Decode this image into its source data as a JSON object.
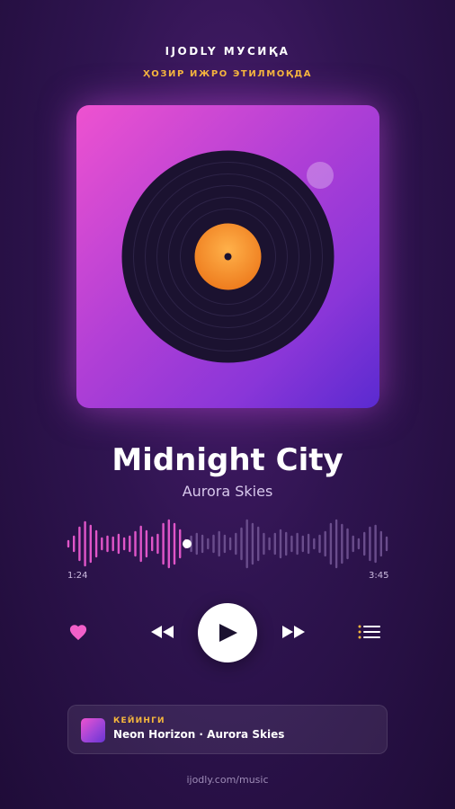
{
  "header": {
    "app_title": "IJODLY МУСИҚА",
    "now_playing": "ҲОЗИР ИЖРО ЭТИЛМОҚДА"
  },
  "track": {
    "title": "Midnight City",
    "artist": "Aurora Skies"
  },
  "progress": {
    "current_time": "1:24",
    "total_time": "3:45",
    "fraction": 0.373
  },
  "controls": {
    "like_icon": "heart-icon",
    "rewind_icon": "rewind-icon",
    "play_icon": "play-icon",
    "forward_icon": "fast-forward-icon",
    "queue_icon": "queue-icon",
    "liked": true
  },
  "up_next": {
    "label": "КЕЙИНГИ",
    "track": "Neon Horizon · Aurora Skies"
  },
  "footer": {
    "url": "ijodly.com/music"
  },
  "colors": {
    "accent_pink": "#ee52d0",
    "accent_gold": "#f6b73c",
    "played_bar": "#e055c8",
    "unplayed_bar": "#6a4d8c"
  }
}
